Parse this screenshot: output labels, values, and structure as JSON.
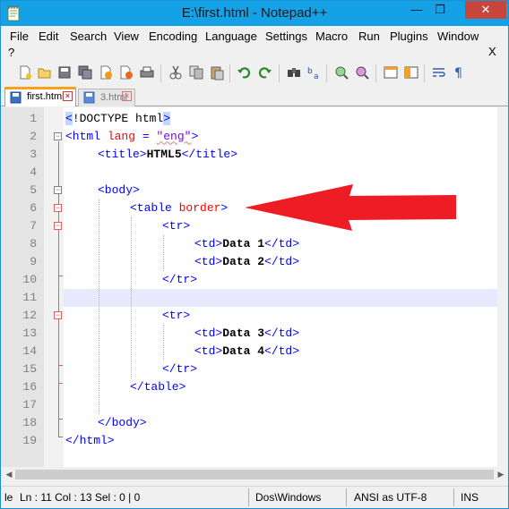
{
  "window": {
    "title": "E:\\first.html - Notepad++",
    "minimize_glyph": "—",
    "maximize_glyph": "❐",
    "close_glyph": "✕"
  },
  "menu": {
    "items": [
      "File",
      "Edit",
      "Search",
      "View",
      "Encoding",
      "Language",
      "Settings",
      "Macro",
      "Run",
      "Plugins",
      "Window"
    ],
    "help": "?",
    "close_doc": "X"
  },
  "toolbar": {
    "icons": [
      "new-file-icon",
      "open-file-icon",
      "save-icon",
      "save-all-icon",
      "close-icon",
      "close-all-icon",
      "print-icon",
      "cut-icon",
      "copy-icon",
      "paste-icon",
      "undo-icon",
      "redo-icon",
      "find-icon",
      "replace-icon",
      "zoom-in-icon",
      "zoom-out-icon",
      "sync-vertical-icon",
      "sync-horizontal-icon",
      "word-wrap-icon",
      "show-all-chars-icon"
    ]
  },
  "tabs": [
    {
      "label": "first.html",
      "active": true
    },
    {
      "label": "3.html",
      "active": false
    }
  ],
  "editor": {
    "line_numbers": [
      "1",
      "2",
      "3",
      "4",
      "5",
      "6",
      "7",
      "8",
      "9",
      "10",
      "11",
      "12",
      "13",
      "14",
      "15",
      "16",
      "17",
      "18",
      "19"
    ],
    "current_line": 11
  },
  "code": {
    "l1": {
      "open": "<",
      "doctype": "!DOCTYPE html",
      "close": ">"
    },
    "l2": {
      "tag_open": "<html ",
      "attr": "lang",
      "eq": " = ",
      "val": "\"eng\"",
      "tag_close": ">"
    },
    "l3": {
      "open": "<title>",
      "text": "HTML5",
      "close": "</title>"
    },
    "l5": {
      "tag": "<body>"
    },
    "l6": {
      "tag_open": "<table ",
      "attr": "border",
      "tag_close": ">"
    },
    "l7": {
      "tag": "<tr>"
    },
    "l8": {
      "open": "<td>",
      "text": "Data 1",
      "close": "</td>"
    },
    "l9": {
      "open": "<td>",
      "text": "Data 2",
      "close": "</td>"
    },
    "l10": {
      "tag": "</tr>"
    },
    "l12": {
      "tag": "<tr>"
    },
    "l13": {
      "open": "<td>",
      "text": "Data 3",
      "close": "</td>"
    },
    "l14": {
      "open": "<td>",
      "text": "Data 4",
      "close": "</td>"
    },
    "l15": {
      "tag": "</tr>"
    },
    "l16": {
      "tag": "</table>"
    },
    "l18": {
      "tag": "</body>"
    },
    "l19": {
      "tag": "</html>"
    }
  },
  "status": {
    "length": "le",
    "position": "Ln : 11    Col : 13    Sel : 0 | 0",
    "eol": "Dos\\Windows",
    "encoding": "ANSI as UTF-8",
    "mode": "INS"
  },
  "colors": {
    "titlebar": "#15a1e6",
    "tag": "#0000ff",
    "attribute": "#ff0000",
    "string": "#8000ff",
    "annotation_arrow": "#ee1c24",
    "tab_accent": "#f7a21c"
  }
}
